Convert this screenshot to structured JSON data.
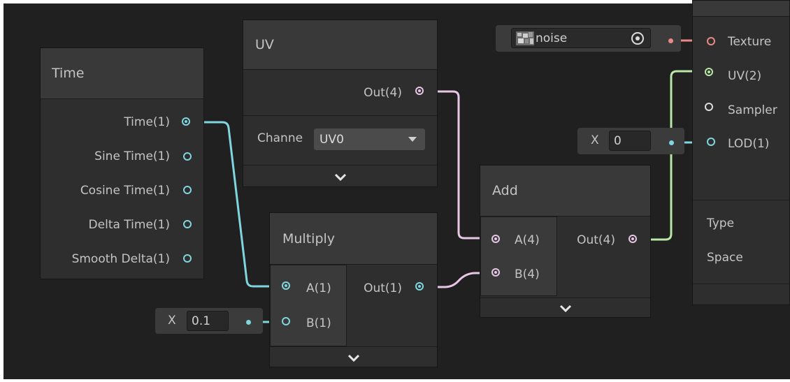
{
  "nodes": {
    "time": {
      "title": "Time",
      "outputs": [
        "Time(1)",
        "Sine Time(1)",
        "Cosine Time(1)",
        "Delta Time(1)",
        "Smooth Delta(1)"
      ]
    },
    "uv": {
      "title": "UV",
      "output": "Out(4)",
      "channel_label": "Channe",
      "channel_value": "UV0"
    },
    "multiply": {
      "title": "Multiply",
      "inputs": [
        "A(1)",
        "B(1)"
      ],
      "output": "Out(1)"
    },
    "add": {
      "title": "Add",
      "inputs": [
        "A(4)",
        "B(4)"
      ],
      "output": "Out(4)"
    },
    "sample": {
      "inputs": [
        "Texture",
        "UV(2)",
        "Sampler",
        "LOD(1)"
      ],
      "props": [
        "Type",
        "Space"
      ]
    }
  },
  "inline_inputs": {
    "texture_field": "noise",
    "lod_x_label": "X",
    "lod_value": "0",
    "multiply_b_x_label": "X",
    "multiply_b_value": "0.1"
  },
  "colors": {
    "float_port": "#7fd6df",
    "vector4_port": "#e7c6e6",
    "vector2_port": "#b9e6a6",
    "texture_port": "#ea8a86",
    "sampler_port": "#dcdcdc"
  },
  "icons": {
    "dropdown": "triangle-down-icon",
    "expand": "chevron-down-icon",
    "texture_picker": "target-icon",
    "texture_thumb": "noise-thumbnail-icon"
  }
}
